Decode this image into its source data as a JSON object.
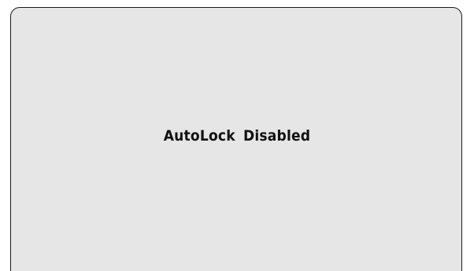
{
  "dialog": {
    "message": "AutoLock Disabled"
  },
  "colors": {
    "panel_background": "#e6e6e7",
    "panel_border": "#1a1a1a",
    "text": "#111111",
    "page_background": "#ffffff"
  }
}
